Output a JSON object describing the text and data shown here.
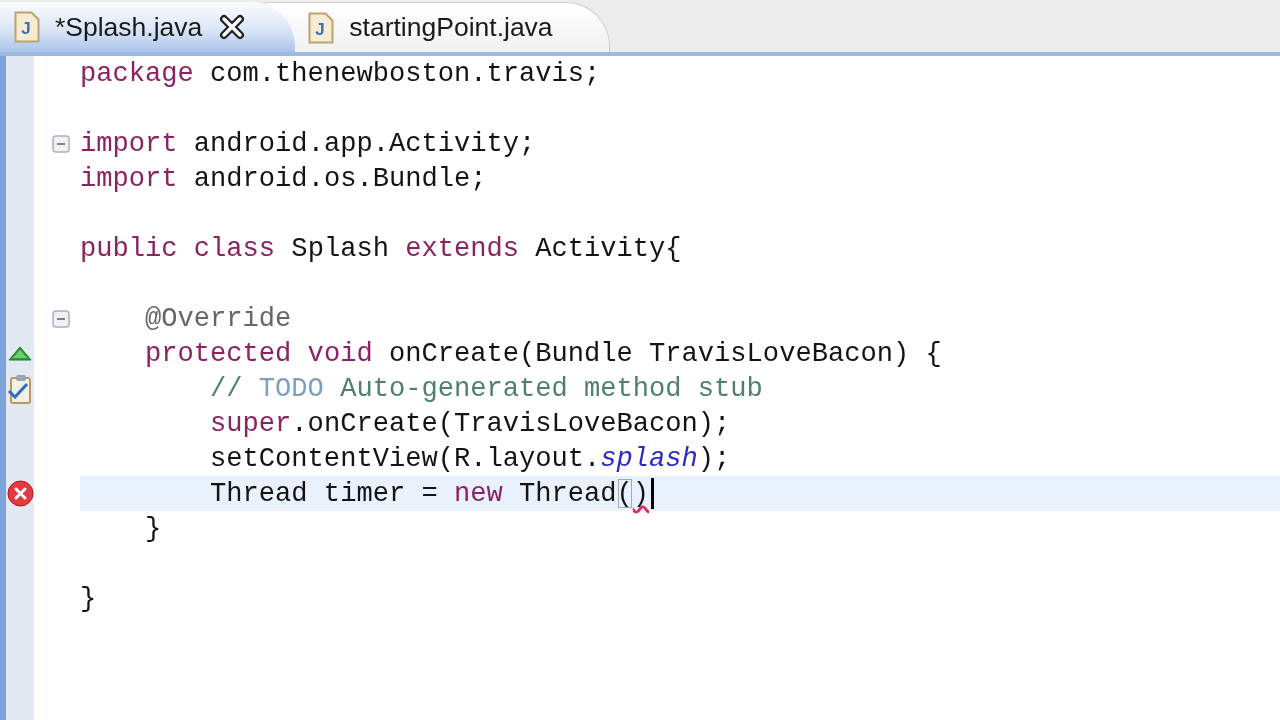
{
  "tabs": [
    {
      "label": "*Splash.java",
      "icon_letter": "J",
      "selected": true
    },
    {
      "label": "startingPoint.java",
      "icon_letter": "J",
      "selected": false
    }
  ],
  "code": [
    {
      "kind": "code",
      "current": false,
      "tokens": [
        {
          "kind": "keyword",
          "text": "package"
        },
        {
          "kind": "plain",
          "text": " com.thenewboston.travis;"
        }
      ]
    },
    {
      "kind": "blank",
      "current": false
    },
    {
      "kind": "code",
      "current": false,
      "fold": {
        "expanded": true
      },
      "tokens": [
        {
          "kind": "keyword",
          "text": "import"
        },
        {
          "kind": "plain",
          "text": " android.app.Activity;"
        }
      ]
    },
    {
      "kind": "code",
      "current": false,
      "tokens": [
        {
          "kind": "keyword",
          "text": "import"
        },
        {
          "kind": "plain",
          "text": " android.os.Bundle;"
        }
      ]
    },
    {
      "kind": "blank",
      "current": false
    },
    {
      "kind": "code",
      "current": false,
      "tokens": [
        {
          "kind": "keyword",
          "text": "public class"
        },
        {
          "kind": "plain",
          "text": " Splash "
        },
        {
          "kind": "keyword",
          "text": "extends"
        },
        {
          "kind": "plain",
          "text": " Activity{"
        }
      ],
      "children": [
        {
          "kind": "blank",
          "current": false
        },
        {
          "kind": "code",
          "current": false,
          "fold": {
            "expanded": true
          },
          "tokens": [
            {
              "kind": "annotation",
              "text": "@Override"
            }
          ]
        },
        {
          "kind": "code",
          "current": false,
          "marker": {
            "kind": "override"
          },
          "tokens": [
            {
              "kind": "keyword",
              "text": "protected void"
            },
            {
              "kind": "plain",
              "text": " onCreate(Bundle TravisLoveBacon) {"
            }
          ],
          "children": [
            {
              "kind": "code",
              "current": false,
              "marker": {
                "kind": "task"
              },
              "tokens": [
                {
                  "kind": "comment",
                  "text": "// "
                },
                {
                  "kind": "todo",
                  "text": "TODO"
                },
                {
                  "kind": "comment",
                  "text": " Auto-generated method stub"
                }
              ]
            },
            {
              "kind": "code",
              "current": false,
              "tokens": [
                {
                  "kind": "keyword",
                  "text": "super"
                },
                {
                  "kind": "plain",
                  "text": ".onCreate(TravisLoveBacon);"
                }
              ]
            },
            {
              "kind": "code",
              "current": false,
              "tokens": [
                {
                  "kind": "plain",
                  "text": "setContentView(R.layout."
                },
                {
                  "kind": "static",
                  "text": "splash"
                },
                {
                  "kind": "plain",
                  "text": ");"
                }
              ]
            },
            {
              "kind": "code",
              "current": true,
              "marker": {
                "kind": "error"
              },
              "tokens": [
                {
                  "kind": "plain",
                  "text": "Thread timer = "
                },
                {
                  "kind": "keyword",
                  "text": "new"
                },
                {
                  "kind": "plain",
                  "text": " Thread"
                },
                {
                  "kind": "matched-bracket",
                  "text": "("
                },
                {
                  "kind": "error",
                  "text": ")"
                }
              ]
            }
          ]
        },
        {
          "kind": "code",
          "current": false,
          "tokens": [
            {
              "kind": "plain",
              "text": "}"
            }
          ]
        },
        {
          "kind": "blank",
          "current": false
        }
      ]
    },
    {
      "kind": "code",
      "current": false,
      "tokens": [
        {
          "kind": "plain",
          "text": "}"
        }
      ]
    }
  ]
}
